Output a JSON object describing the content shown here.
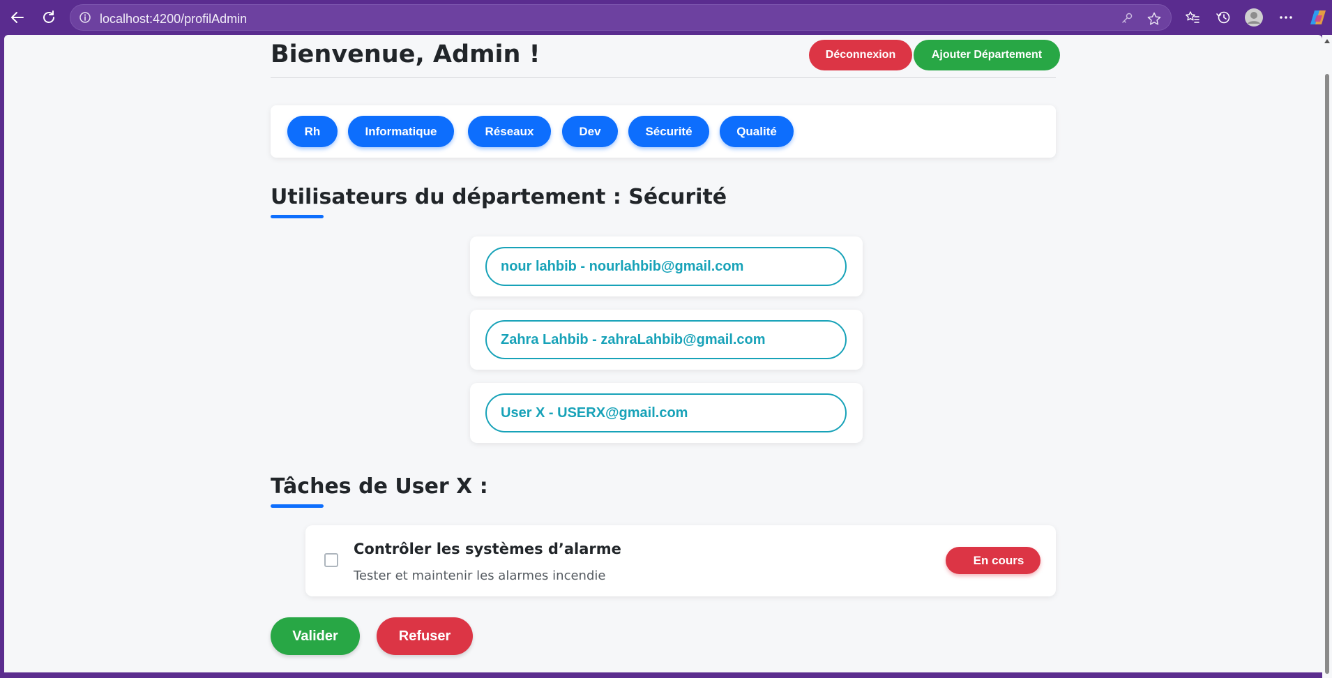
{
  "browser": {
    "url": "localhost:4200/profilAdmin",
    "icons": [
      "back-icon",
      "refresh-icon",
      "info-icon",
      "key-icon",
      "star-icon",
      "favorites-icon",
      "history-icon",
      "profile-icon",
      "more-icon",
      "copilot-icon"
    ]
  },
  "header": {
    "welcome": "Bienvenue, Admin !",
    "logout_label": "Déconnexion",
    "add_department_label": "Ajouter Département"
  },
  "departments": [
    {
      "label": "Rh"
    },
    {
      "label": "Informatique"
    },
    {
      "label": "Réseaux"
    },
    {
      "label": "Dev"
    },
    {
      "label": "Sécurité"
    },
    {
      "label": "Qualité"
    }
  ],
  "users_section": {
    "title": "Utilisateurs du département : Sécurité",
    "users": [
      {
        "label": "nour lahbib - nourlahbib@gmail.com"
      },
      {
        "label": "Zahra Lahbib - zahraLahbib@gmail.com"
      },
      {
        "label": "User X - USERX@gmail.com"
      }
    ]
  },
  "tasks_section": {
    "title": "Tâches de User X :",
    "tasks": [
      {
        "title": "Contrôler les systèmes d’alarme",
        "description": "Tester et maintenir les alarmes incendie",
        "status": "En cours",
        "checked": false
      }
    ]
  },
  "actions": {
    "validate_label": "Valider",
    "refuse_label": "Refuser"
  },
  "colors": {
    "primary": "#0d6efd",
    "success": "#28a745",
    "danger": "#dc3545",
    "info": "#17a2b8",
    "browser_frame": "#5a2c8f"
  }
}
